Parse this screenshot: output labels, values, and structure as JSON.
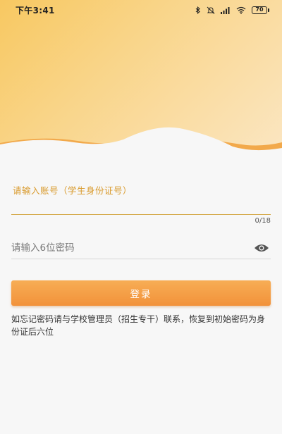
{
  "status_bar": {
    "time": "下午3:41",
    "battery": "70"
  },
  "login": {
    "account_label": "请输入账号（学生身份证号）",
    "account_value": "",
    "account_counter": "0/18",
    "password_placeholder": "请输入6位密码",
    "login_button": "登录",
    "hint": "如忘记密码请与学校管理员（招生专干）联系，恢复到初始密码为身份证后六位"
  },
  "colors": {
    "accent": "#f2923a",
    "label": "#d99a2b",
    "header_start": "#f8c861",
    "header_end": "#fbe6c2"
  }
}
